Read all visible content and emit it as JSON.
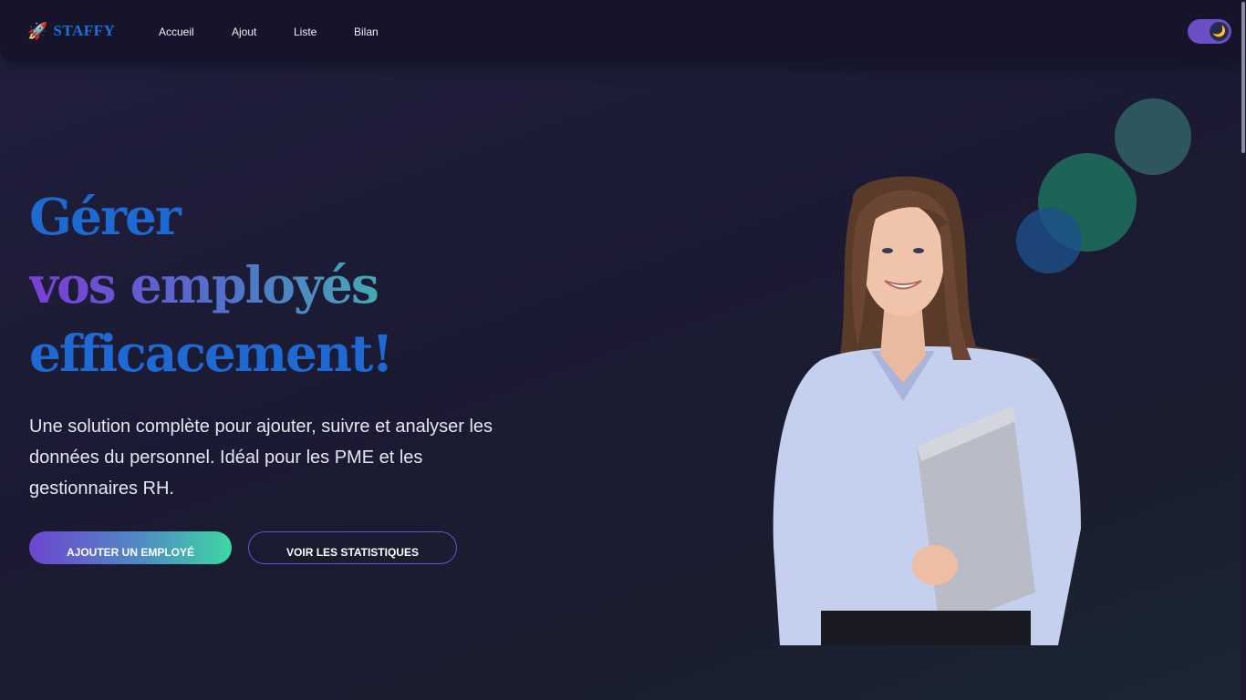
{
  "nav": {
    "logo_icon": "rocket-icon",
    "logo_glyph": "🚀",
    "logo_text": "STAFFY",
    "links": [
      "Accueil",
      "Ajout",
      "Liste",
      "Bilan"
    ],
    "theme_toggle": {
      "icon": "moon-icon",
      "glyph": "🌙",
      "state": "dark"
    }
  },
  "hero": {
    "headline_line1": "Gérer",
    "headline_line2": "vos employés",
    "headline_line3": "efficacement!",
    "subtitle": "Une solution complète pour ajouter, suivre et analyser les données du personnel. Idéal pour les PME et les gestionnaires RH.",
    "primary_button": "Ajouter un employé",
    "secondary_button": "Voir les statistiques",
    "image": "woman-with-laptop-photo"
  },
  "colors": {
    "background": "#1b1a33",
    "brand_blue": "#1f6ad2",
    "accent_purple": "#6e45cf",
    "accent_green": "#3fd6a2"
  }
}
